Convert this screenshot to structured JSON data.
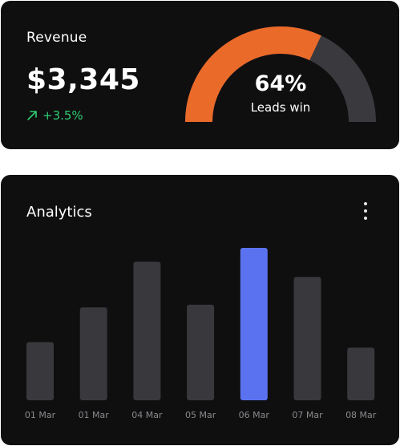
{
  "revenue": {
    "title": "Revenue",
    "value": "$3,345",
    "change": "+3.5%",
    "change_icon": "arrow-up-right-icon",
    "change_color": "#2ecc71"
  },
  "gauge": {
    "percent_text": "64%",
    "label": "Leads win",
    "fraction": 0.64,
    "fill_color": "#ea6a2a",
    "track_color": "#3a3a3e"
  },
  "analytics": {
    "title": "Analytics",
    "menu_icon": "more-vertical-icon"
  },
  "chart_data": {
    "type": "bar",
    "categories": [
      "01 Mar",
      "01 Mar",
      "04 Mar",
      "05 Mar",
      "06 Mar",
      "07 Mar",
      "08 Mar"
    ],
    "values": [
      42,
      67,
      100,
      69,
      110,
      89,
      38
    ],
    "highlight_index": 4,
    "bar_color": "#38383d",
    "highlight_color": "#5b72f0",
    "ylim": [
      0,
      110
    ],
    "grid": false
  }
}
